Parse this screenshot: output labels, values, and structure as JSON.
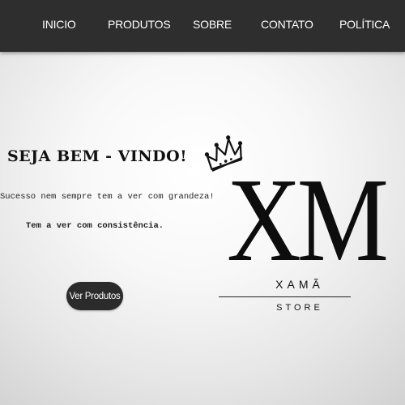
{
  "nav": {
    "items": [
      {
        "label": "INICIO"
      },
      {
        "label": "PRODUTOS"
      },
      {
        "label": "SOBRE"
      },
      {
        "label": "CONTATO"
      },
      {
        "label": "POLÍTICA"
      }
    ]
  },
  "hero": {
    "title": "SEJA BEM - VINDO!",
    "tagline": "Sucesso nem sempre tem a ver com grandeza!",
    "subtagline": "Tem a ver com consistência.",
    "cta_label": "Ver Produtos"
  },
  "logo": {
    "monogram": "XM",
    "name": "XAMÃ",
    "subtitle": "STORE",
    "icon": "crown-icon"
  },
  "colors": {
    "navbar": "#2e2e2e",
    "nav_text": "#ffffff",
    "button": "#2b2b2b",
    "text": "#111111"
  }
}
